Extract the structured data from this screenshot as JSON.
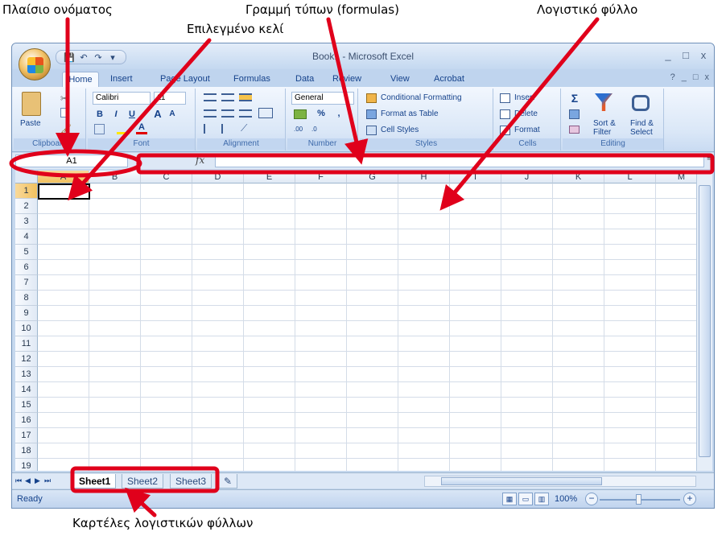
{
  "annotations": {
    "name_box": "Πλαίσιο ονόματος",
    "formula_bar": "Γραμμή τύπων (formulas)",
    "spreadsheet": "Λογιστικό φύλλο",
    "selected_cell": "Επιλεγμένο κελί",
    "sheet_tabs": "Καρτέλες λογιστικών φύλλων",
    "color": "#e0001b"
  },
  "window": {
    "title": "Book1 - Microsoft Excel",
    "controls": [
      "_",
      "□",
      "x"
    ],
    "quick_access": [
      "💾",
      "↶",
      "↷",
      "▾"
    ]
  },
  "tabs": [
    "Home",
    "Insert",
    "Page Layout",
    "Formulas",
    "Data",
    "Review",
    "View",
    "Acrobat"
  ],
  "active_tab": "Home",
  "help_controls": [
    "?",
    "_",
    "□",
    "x"
  ],
  "ribbon": {
    "clipboard": {
      "label": "Clipboard",
      "paste": "Paste"
    },
    "font": {
      "label": "Font",
      "name": "Calibri",
      "size": "11",
      "bold": "B",
      "italic": "I",
      "underline": "U",
      "grow": "A",
      "shrink": "A"
    },
    "alignment": {
      "label": "Alignment"
    },
    "number": {
      "label": "Number",
      "format": "General",
      "percent": "%",
      "comma": ",",
      "inc": ".00",
      "dec": ".0"
    },
    "styles": {
      "label": "Styles",
      "conditional": "Conditional Formatting",
      "table": "Format as Table",
      "cell": "Cell Styles"
    },
    "cells": {
      "label": "Cells",
      "insert": "Insert",
      "delete": "Delete",
      "format": "Format"
    },
    "editing": {
      "label": "Editing",
      "sigma": "Σ",
      "sort": "Sort &",
      "filter": "Filter",
      "find": "Find &",
      "select": "Select"
    }
  },
  "formula_bar": {
    "name_box": "A1",
    "fx": "fx",
    "value": ""
  },
  "columns": [
    "A",
    "B",
    "C",
    "D",
    "E",
    "F",
    "G",
    "H",
    "I",
    "J",
    "K",
    "L",
    "M"
  ],
  "rows": [
    "1",
    "2",
    "3",
    "4",
    "5",
    "6",
    "7",
    "8",
    "9",
    "10",
    "11",
    "12",
    "13",
    "14",
    "15",
    "16",
    "17",
    "18",
    "19"
  ],
  "selected_cell": "A1",
  "sheets": [
    "Sheet1",
    "Sheet2",
    "Sheet3"
  ],
  "active_sheet": "Sheet1",
  "status": {
    "text": "Ready",
    "zoom": "100%"
  }
}
